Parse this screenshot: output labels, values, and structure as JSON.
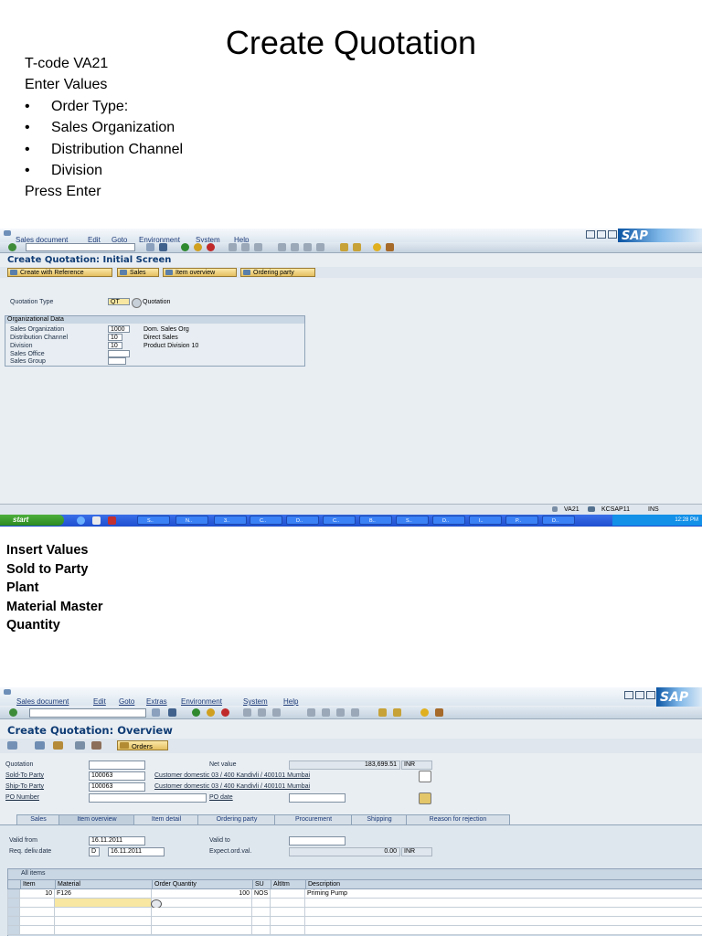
{
  "slide": {
    "title": "Create Quotation",
    "intro_lines": [
      "T-code VA21",
      "Enter  Values"
    ],
    "bullets": [
      "Order Type:",
      "Sales Organization",
      "Distribution Channel",
      "Division"
    ],
    "press_enter": "Press Enter",
    "bullet_char": "•",
    "insert_values": [
      "Insert Values",
      "Sold to Party",
      "Plant",
      "Material Master",
      "Quantity"
    ]
  },
  "screen1": {
    "menu": [
      "Sales document",
      "Edit",
      "Goto",
      "Environment",
      "System",
      "Help"
    ],
    "sap_logo": "SAP",
    "title": "Create Quotation: Initial Screen",
    "app_buttons": [
      "Create with Reference",
      "Sales",
      "Item overview",
      "Ordering party"
    ],
    "quotation_type_label": "Quotation Type",
    "quotation_type_value": "QT",
    "quotation_type_desc": "Quotation",
    "org_frame_title": "Organizational Data",
    "org_rows": [
      {
        "label": "Sales Organization",
        "value": "1000",
        "desc": "Dom. Sales Org"
      },
      {
        "label": "Distribution Channel",
        "value": "10",
        "desc": "Direct Sales"
      },
      {
        "label": "Division",
        "value": "10",
        "desc": "Product Division 10"
      },
      {
        "label": "Sales Office",
        "value": "",
        "desc": ""
      },
      {
        "label": "Sales Group",
        "value": "",
        "desc": ""
      }
    ],
    "status": {
      "tcode": "VA21",
      "server": "KCSAP11",
      "mode": "INS"
    },
    "taskbar": {
      "start": "start",
      "tasks": [
        "S..",
        "N..",
        "3..",
        "C..",
        "D..",
        "C..",
        "B..",
        "S..",
        "D..",
        "I..",
        "P..",
        "D.."
      ],
      "clock": "12:28 PM"
    }
  },
  "screen2": {
    "menu": [
      "Sales document",
      "Edit",
      "Goto",
      "Extras",
      "Environment",
      "System",
      "Help"
    ],
    "sap_logo": "SAP",
    "title": "Create Quotation: Overview",
    "orders_button": "Orders",
    "fields": {
      "quotation_label": "Quotation",
      "quotation_value": "",
      "net_value_label": "Net value",
      "net_value": "183,699.51",
      "currency": "INR",
      "sold_to_label": "Sold-To Party",
      "sold_to_value": "100063",
      "sold_to_desc": "Customer domestic 03 / 400 Kandivli / 400101 Mumbai",
      "ship_to_label": "Ship-To Party",
      "ship_to_value": "100063",
      "ship_to_desc": "Customer domestic 03 / 400 Kandivli / 400101 Mumbai",
      "po_number_label": "PO Number",
      "po_number_value": "",
      "po_date_label": "PO date",
      "po_date_value": ""
    },
    "tabs": [
      "Sales",
      "Item overview",
      "Item detail",
      "Ordering party",
      "Procurement",
      "Shipping",
      "Reason for rejection"
    ],
    "active_tab": "Item overview",
    "valid_from_label": "Valid from",
    "valid_from": "16.11.2011",
    "valid_to_label": "Valid to",
    "valid_to": "",
    "req_deliv_label": "Req. deliv.date",
    "req_deliv_type": "D",
    "req_deliv_date": "16.11.2011",
    "expect_label": "Expect.ord.val.",
    "expect_value": "0.00",
    "expect_currency": "INR",
    "items_title": "All items",
    "columns": [
      "Item",
      "Material",
      "Order Quantity",
      "SU",
      "AltItm",
      "Description"
    ],
    "rows": [
      {
        "item": "10",
        "material": "F126",
        "qty": "100",
        "su": "NOS",
        "altitm": "",
        "desc": "Priming Pump"
      }
    ]
  }
}
